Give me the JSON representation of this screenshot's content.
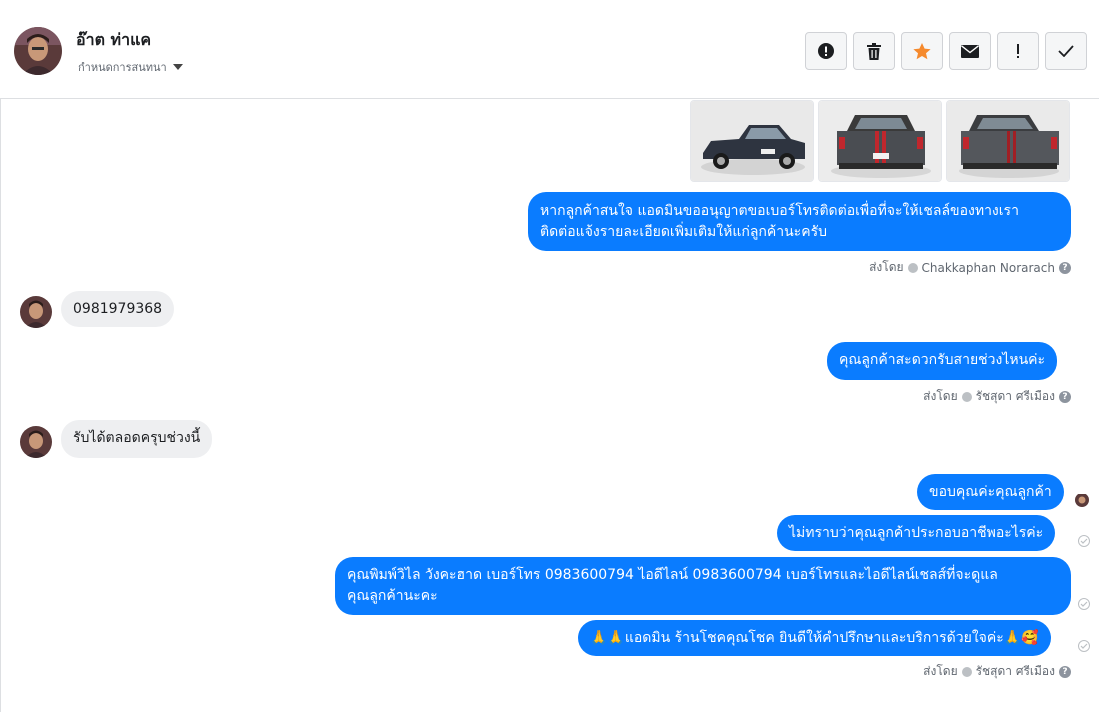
{
  "header": {
    "contact_name": "อ๊าต ท่าแค",
    "sub_label": "กำหนดการสนทนา"
  },
  "toolbar": {
    "icons": [
      "alert-circle-icon",
      "trash-icon",
      "star-icon",
      "envelope-icon",
      "exclamation-icon",
      "check-icon"
    ],
    "star_color": "#f58a2e"
  },
  "messages": {
    "m1": "หากลูกค้าสนใจ แอดมินขออนุญาตขอเบอร์โทรติดต่อเพื่อที่จะให้เชลล์ของทางเรา",
    "m1b": "ติดต่อแจ้งรายละเอียดเพิ่มเติมให้แก่ลูกค้านะครับ",
    "sentby1_prefix": "ส่งโดย",
    "sentby1_name": "Chakkaphan Norarach",
    "in1": "0981979368",
    "m2": "คุณลูกค้าสะดวกรับสายช่วงไหนค่ะ",
    "sentby2_prefix": "ส่งโดย",
    "sentby2_name": "รัชสุดา ศรีเมือง",
    "in2": "รับได้ตลอดครุบช่วงนี้",
    "m3": "ขอบคุณค่ะคุณลูกค้า",
    "m4": "ไม่ทราบว่าคุณลูกค้าประกอบอาชีพอะไรค่ะ",
    "m5a": "คุณพิมพ์วิไล วังคะฮาด   เบอร์โทร 0983600794  ไอดีไลน์ 0983600794  เบอร์โทรและไอดีไลน์เชลส์ที่จะดูแล",
    "m5b": "คุณลูกค้านะคะ",
    "m6": "🙏🙏แอดมิน ร้านโชคคุณโชค ยินดีให้คำปรึกษาและบริการด้วยใจค่ะ🙏🥰",
    "sentby3_prefix": "ส่งโดย",
    "sentby3_name": "รัชสุดา ศรีเมือง",
    "help_mark": "?"
  },
  "colors": {
    "outgoing_bubble": "#0a7cff",
    "incoming_bubble": "#eeeff1"
  }
}
